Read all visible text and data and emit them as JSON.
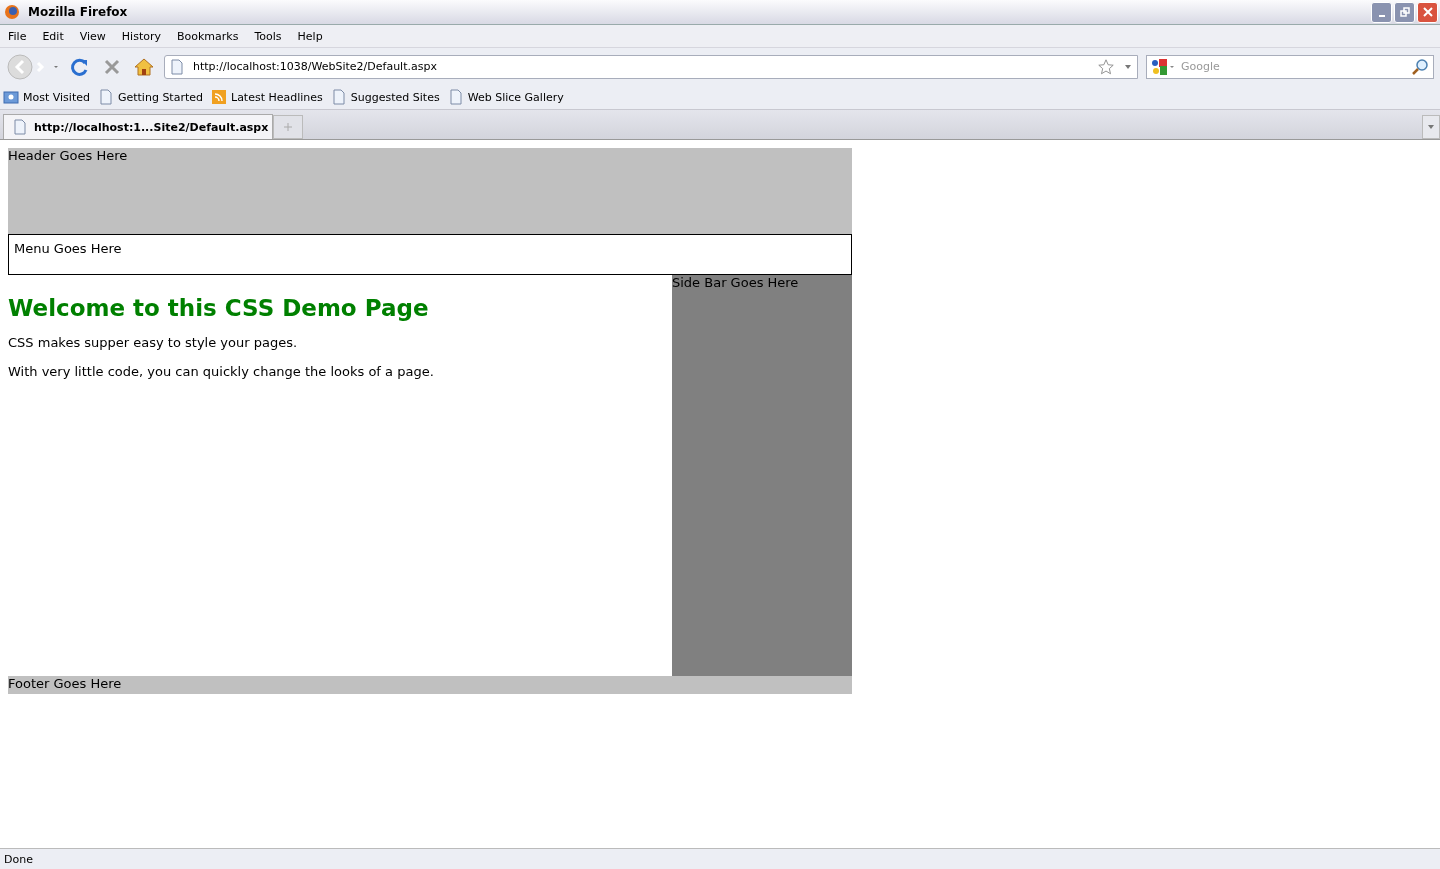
{
  "window": {
    "title": "Mozilla Firefox"
  },
  "menu_bar": [
    "File",
    "Edit",
    "View",
    "History",
    "Bookmarks",
    "Tools",
    "Help"
  ],
  "address_bar": {
    "value": "http://localhost:1038/WebSite2/Default.aspx"
  },
  "search": {
    "placeholder": "Google"
  },
  "bookmarks": [
    {
      "label": "Most Visited",
      "kind": "folder"
    },
    {
      "label": "Getting Started",
      "kind": "page"
    },
    {
      "label": "Latest Headlines",
      "kind": "feed"
    },
    {
      "label": "Suggested Sites",
      "kind": "page"
    },
    {
      "label": "Web Slice Gallery",
      "kind": "page"
    }
  ],
  "tabs": [
    {
      "label": "http://localhost:1...Site2/Default.aspx",
      "selected": true
    }
  ],
  "page": {
    "header": "Header Goes Here",
    "menu": "Menu Goes Here",
    "heading": "Welcome to this CSS Demo Page",
    "paragraphs": [
      "CSS makes supper easy to style your pages.",
      "With very little code, you can quickly change the looks of a page."
    ],
    "sidebar": "Side Bar Goes Here",
    "footer": "Footer Goes Here"
  },
  "status_bar": "Done"
}
